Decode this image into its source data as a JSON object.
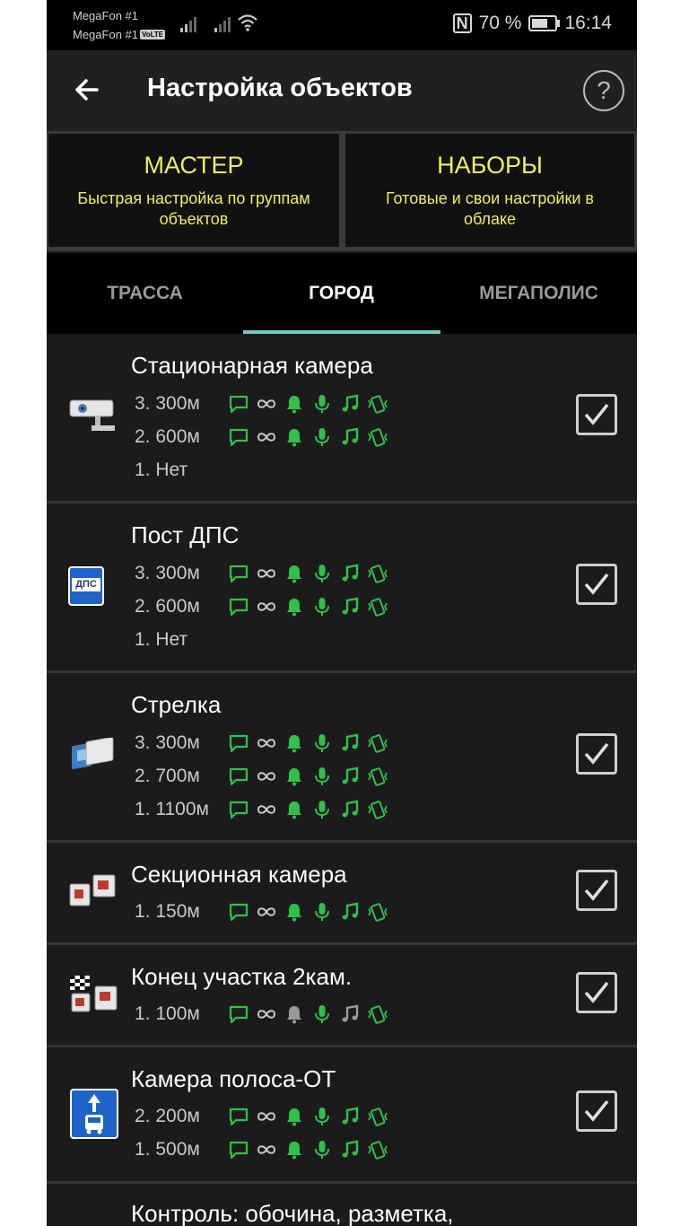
{
  "status_bar": {
    "carrier_1": "MegaFon #1",
    "carrier_2": "MegaFon #1",
    "volte": "VoLTE",
    "nfc": "N",
    "battery": "70 %",
    "battery_level": 0.7,
    "time": "16:14"
  },
  "appbar": {
    "title": "Настройка объектов",
    "help": "?"
  },
  "cards": {
    "master": {
      "title": "МАСТЕР",
      "subtitle": "Быстрая настройка по группам объектов"
    },
    "sets": {
      "title": "НАБОРЫ",
      "subtitle": "Готовые и свои настройки в облаке"
    }
  },
  "tabs": [
    {
      "label": "ТРАССА"
    },
    {
      "label": "ГОРОД",
      "active": true
    },
    {
      "label": "МЕГАПОЛИС"
    }
  ],
  "colors": {
    "icon_green": "#2fc14a",
    "icon_grey": "#9a9a9a",
    "accent_yellow": "#f0f05a",
    "tab_indicator": "#7bc7c0"
  },
  "items": [
    {
      "name": "Стационарная камера",
      "icon": "stationary-camera-icon",
      "checked": true,
      "levels": [
        {
          "label": "3. 300м",
          "icons": true,
          "bell": "green",
          "note": "green"
        },
        {
          "label": "2. 600м",
          "icons": true,
          "bell": "green",
          "note": "green"
        },
        {
          "label": "1. Нет",
          "icons": false
        }
      ]
    },
    {
      "name": "Пост ДПС",
      "icon": "dps-post-icon",
      "icon_text": "ДПС",
      "checked": true,
      "levels": [
        {
          "label": "3. 300м",
          "icons": true,
          "bell": "green",
          "note": "green"
        },
        {
          "label": "2. 600м",
          "icons": true,
          "bell": "green",
          "note": "green"
        },
        {
          "label": "1. Нет",
          "icons": false
        }
      ]
    },
    {
      "name": "Стрелка",
      "icon": "strelka-radar-icon",
      "checked": true,
      "levels": [
        {
          "label": "3. 300м",
          "icons": true,
          "bell": "green",
          "note": "green"
        },
        {
          "label": "2. 700м",
          "icons": true,
          "bell": "green",
          "note": "green"
        },
        {
          "label": "1. 1100м",
          "icons": true,
          "bell": "green",
          "note": "green"
        }
      ]
    },
    {
      "name": "Секционная камера",
      "icon": "section-camera-icon",
      "checked": true,
      "levels": [
        {
          "label": "1. 150м",
          "icons": true,
          "bell": "green",
          "note": "green"
        }
      ]
    },
    {
      "name": "Конец участка 2кам.",
      "icon": "section-end-icon",
      "checked": true,
      "levels": [
        {
          "label": "1. 100м",
          "icons": true,
          "bell": "grey",
          "note": "grey"
        }
      ]
    },
    {
      "name": "Камера полоса-ОТ",
      "icon": "bus-lane-camera-icon",
      "checked": true,
      "levels": [
        {
          "label": "2. 200м",
          "icons": true,
          "bell": "green",
          "note": "green"
        },
        {
          "label": "1. 500м",
          "icons": true,
          "bell": "green",
          "note": "green"
        }
      ]
    },
    {
      "name": "Контроль: обочина, разметка,",
      "icon": "",
      "checked": false,
      "levels": []
    }
  ]
}
